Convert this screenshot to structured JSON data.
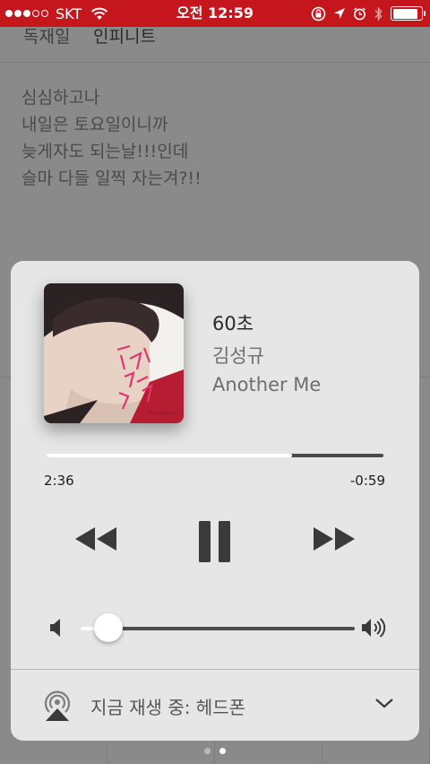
{
  "status_bar": {
    "carrier": "SKT",
    "time": "오전 12:59",
    "signal_bars": 3,
    "signal_total": 5,
    "battery_level": 0.9
  },
  "background_app": {
    "tabs": [
      "독재일",
      "인피니트"
    ],
    "post_lines": [
      "심심하고나",
      "내일은 토요일이니까",
      "늦게자도 되는날!!!인데",
      "슬마 다들 일찍 자는겨?!!"
    ]
  },
  "now_playing": {
    "title": "60초",
    "artist": "김성규",
    "album": "Another Me",
    "elapsed": "2:36",
    "remaining": "-0:59",
    "progress": 0.73,
    "volume": 0.1
  },
  "route": {
    "label": "지금 재생 중: 헤드폰"
  },
  "pager": {
    "count": 2,
    "active": 1
  },
  "colors": {
    "status_bar": "#c4161c",
    "card": "#e7e6e6",
    "accent_pink": "#e0356e"
  }
}
